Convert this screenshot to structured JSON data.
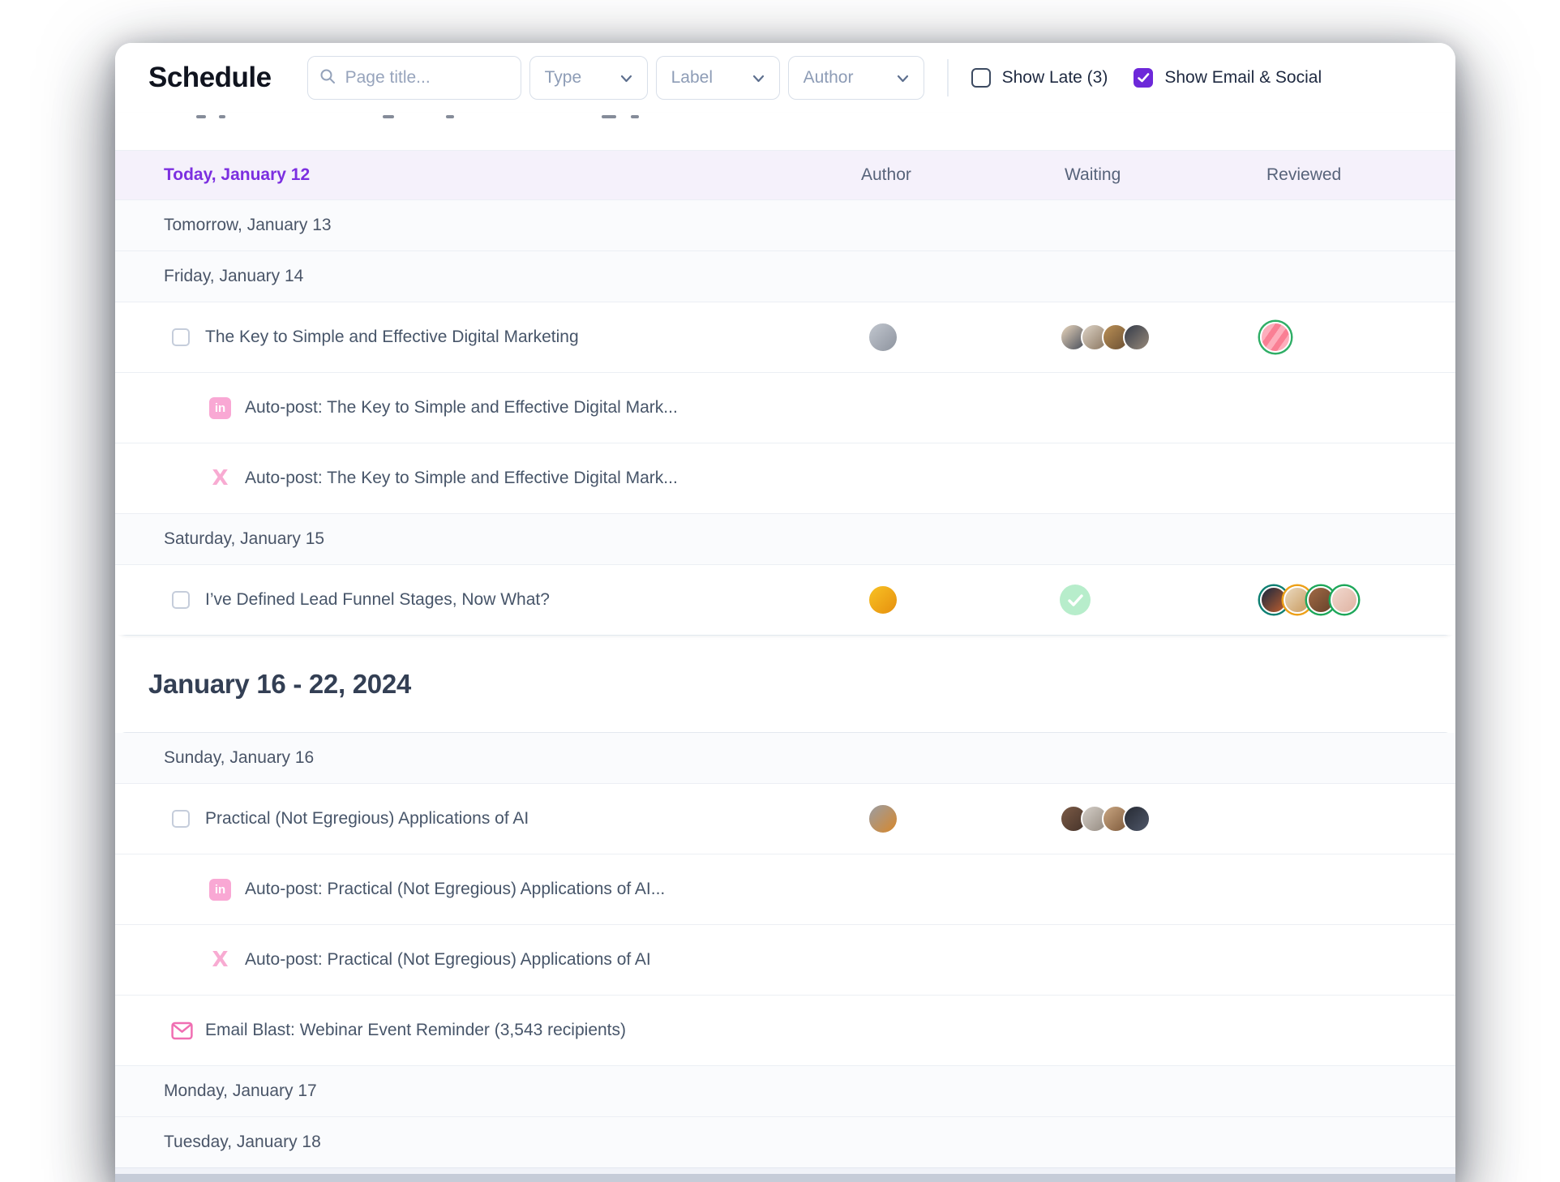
{
  "app": {
    "title": "Schedule"
  },
  "toolbar": {
    "search_placeholder": "Page title...",
    "filters": [
      "Type",
      "Label",
      "Author"
    ],
    "show_late": {
      "label": "Show Late (3)",
      "checked": false
    },
    "show_email_social": {
      "label": "Show Email & Social",
      "checked": true
    }
  },
  "columns": [
    "Author",
    "Waiting",
    "Reviewed"
  ],
  "colors": {
    "accent_purple": "#7c2fe0",
    "checkbox_purple": "#6d28d9",
    "pink": "#f9a8d4",
    "pink_strong": "#f06eb2",
    "mint_check_bg": "#b7edcb",
    "today_row_bg": "#f5f1fb"
  },
  "week2_heading": "January 16 - 22, 2024",
  "table1": {
    "rows": [
      {
        "type": "clipped"
      },
      {
        "type": "today",
        "label": "Today, January 12"
      },
      {
        "type": "day",
        "label": "Tomorrow, January 13"
      },
      {
        "type": "day",
        "label": "Friday, January 14"
      },
      {
        "type": "page",
        "title": "The Key to Simple and Effective Digital Marketing",
        "author": {
          "c": [
            "#c2c7cf",
            "#8d939e"
          ]
        },
        "waiting": [
          {
            "c": [
              "#e9d6bd",
              "#454b58"
            ]
          },
          {
            "c": [
              "#ddd3c6",
              "#8a7660"
            ]
          },
          {
            "c": [
              "#bb9055",
              "#6a4f33"
            ]
          },
          {
            "c": [
              "#343b49",
              "#97897a"
            ]
          }
        ],
        "reviewed": [
          {
            "stripes": [
              "#fa7f94",
              "#fdaebc"
            ],
            "ring": "#2fae66"
          }
        ]
      },
      {
        "type": "social",
        "network": "linkedin",
        "text": "Auto-post: The Key to Simple and Effective Digital Mark..."
      },
      {
        "type": "social",
        "network": "x",
        "text": "Auto-post: The Key to Simple and Effective Digital Mark..."
      },
      {
        "type": "day",
        "label": "Saturday, January 15"
      },
      {
        "type": "page",
        "title": "I’ve Defined Lead Funnel Stages, Now What?",
        "author": {
          "c": [
            "#f8c224",
            "#e68f0e"
          ]
        },
        "waiting_check": true,
        "reviewed": [
          {
            "c": [
              "#16253f",
              "#c2602d"
            ],
            "ring": "#0d7f72"
          },
          {
            "c": [
              "#ead9bf",
              "#c89a5e"
            ],
            "ring": "#eda018"
          },
          {
            "c": [
              "#a06a45",
              "#66412a"
            ],
            "ring": "#1ea75a"
          },
          {
            "c": [
              "#f1d8ce",
              "#dfb3a2"
            ],
            "ring": "#1ea75a"
          }
        ]
      }
    ]
  },
  "table2": {
    "rows": [
      {
        "type": "day",
        "label": "Sunday, January 16"
      },
      {
        "type": "page",
        "title": "Practical (Not Egregious) Applications of AI",
        "author": {
          "c": [
            "#9a9da4",
            "#d8872a"
          ]
        },
        "waiting": [
          {
            "c": [
              "#7c5b46",
              "#45332a"
            ]
          },
          {
            "c": [
              "#d4cec7",
              "#948a80"
            ]
          },
          {
            "c": [
              "#c9a682",
              "#7e5a3b"
            ]
          },
          {
            "c": [
              "#262a33",
              "#50586a"
            ]
          }
        ],
        "reviewed": []
      },
      {
        "type": "social",
        "network": "linkedin",
        "text": "Auto-post: Practical (Not Egregious) Applications of AI..."
      },
      {
        "type": "social",
        "network": "x",
        "text": "Auto-post: Practical (Not Egregious) Applications of AI"
      },
      {
        "type": "email",
        "text": "Email Blast: Webinar Event Reminder (3,543 recipients)"
      },
      {
        "type": "day",
        "label": "Monday, January 17"
      },
      {
        "type": "day",
        "label": "Tuesday, January 18"
      }
    ]
  }
}
